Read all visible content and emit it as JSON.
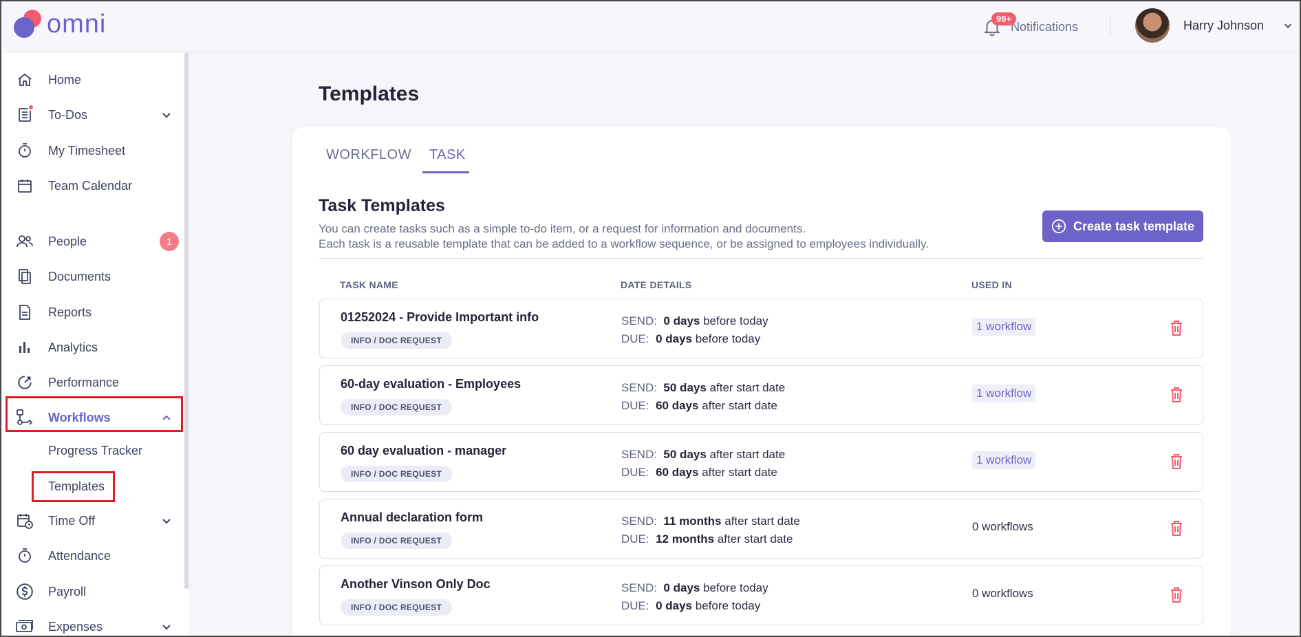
{
  "app": {
    "logo_text": "omni"
  },
  "header": {
    "notifications_badge": "99+",
    "notifications_label": "Notifications",
    "user_name": "Harry Johnson"
  },
  "sidebar": {
    "items": [
      {
        "label": "Home",
        "icon": "home-icon"
      },
      {
        "label": "To-Dos",
        "icon": "todo-list-icon"
      },
      {
        "label": "My Timesheet",
        "icon": "stopwatch-icon"
      },
      {
        "label": "Team Calendar",
        "icon": "calendar-icon"
      },
      {
        "label": "People",
        "icon": "people-icon",
        "badge": "1"
      },
      {
        "label": "Documents",
        "icon": "documents-icon"
      },
      {
        "label": "Reports",
        "icon": "report-icon"
      },
      {
        "label": "Analytics",
        "icon": "bar-chart-icon"
      },
      {
        "label": "Performance",
        "icon": "performance-icon"
      },
      {
        "label": "Workflows",
        "icon": "workflow-icon"
      },
      {
        "label": "Time Off",
        "icon": "calendar-clock-icon"
      },
      {
        "label": "Attendance",
        "icon": "stopwatch-icon"
      },
      {
        "label": "Payroll",
        "icon": "dollar-icon"
      },
      {
        "label": "Expenses",
        "icon": "money-icon"
      }
    ],
    "workflow_sub": [
      "Progress Tracker",
      "Templates"
    ]
  },
  "main": {
    "page_title": "Templates",
    "tabs": [
      "WORKFLOW",
      "TASK"
    ],
    "active_tab": "TASK",
    "section_title": "Task Templates",
    "description_1": "You can create tasks such as a simple to-do item, or a request for information and documents.",
    "description_2": "Each task is a reusable template that can be added to a workflow sequence, or be assigned to employees individually.",
    "create_button": "Create task template",
    "columns": [
      "TASK NAME",
      "DATE DETAILS",
      "USED IN"
    ],
    "send_label": "SEND:",
    "due_label": "DUE:",
    "rows": [
      {
        "name": "01252024 - Provide Important info",
        "tag": "INFO / DOC REQUEST",
        "send_val": "0 days",
        "send_rest": "before today",
        "due_val": "0 days",
        "due_rest": "before today",
        "used_in": "1 workflow",
        "used_link": true
      },
      {
        "name": "60-day evaluation - Employees",
        "tag": "INFO / DOC REQUEST",
        "send_val": "50 days",
        "send_rest": "after start date",
        "due_val": "60 days",
        "due_rest": "after start date",
        "used_in": "1 workflow",
        "used_link": true
      },
      {
        "name": "60 day evaluation - manager",
        "tag": "INFO / DOC REQUEST",
        "send_val": "50 days",
        "send_rest": "after start date",
        "due_val": "60 days",
        "due_rest": "after start date",
        "used_in": "1 workflow",
        "used_link": true
      },
      {
        "name": "Annual declaration form",
        "tag": "INFO / DOC REQUEST",
        "send_val": "11 months",
        "send_rest": "after start date",
        "due_val": "12 months",
        "due_rest": "after start date",
        "used_in": "0 workflows",
        "used_link": false
      },
      {
        "name": "Another Vinson Only Doc",
        "tag": "INFO / DOC REQUEST",
        "send_val": "0 days",
        "send_rest": "before today",
        "due_val": "0 days",
        "due_rest": "before today",
        "used_in": "0 workflows",
        "used_link": false
      }
    ]
  },
  "colors": {
    "accent": "#6b63c7",
    "brand_red": "#f25c6f",
    "highlight": "#e01b24"
  }
}
